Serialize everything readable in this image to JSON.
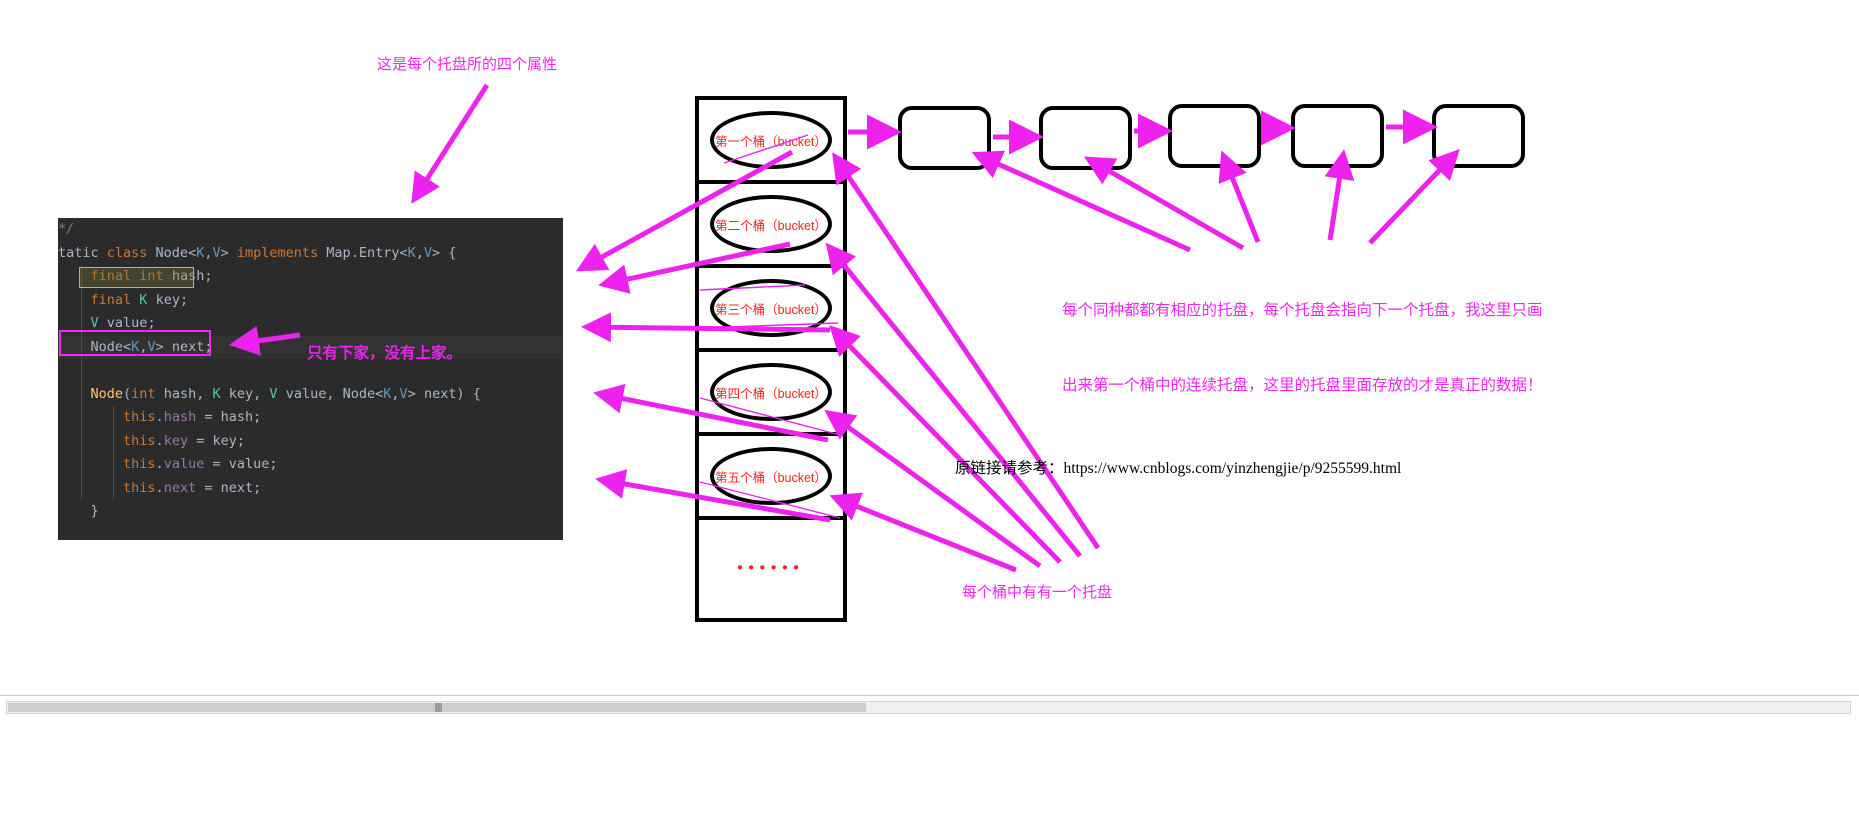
{
  "annotations": {
    "top": "这是每个托盘所的四个属性",
    "next_field": "只有下家，没有上家。",
    "right_line1": "每个同种都都有相应的托盘，每个托盘会指向下一个托盘，我这里只画",
    "right_line2": "出来第一个桶中的连续托盘，这里的托盘里面存放的才是真正的数据！",
    "bottom": "每个桶中有有一个托盘",
    "source_url": "原链接请参考：https://www.cnblogs.com/yinzhengjie/p/9255599.html"
  },
  "code": {
    "language": "java",
    "lines": [
      {
        "id": "l0",
        "text": "*/",
        "indent": 0,
        "highlighted": false
      },
      {
        "id": "l1",
        "text": "tatic class Node<K,V> implements Map.Entry<K,V> {",
        "indent": 0,
        "highlighted": false
      },
      {
        "id": "l2",
        "text": "    final int hash;",
        "indent": 1,
        "highlighted": false
      },
      {
        "id": "l3",
        "text": "    final K key;",
        "indent": 1,
        "highlighted": false
      },
      {
        "id": "l4",
        "text": "    V value;",
        "indent": 1,
        "highlighted": false
      },
      {
        "id": "l5",
        "text": "    Node<K,V> next;",
        "indent": 1,
        "highlighted": true
      },
      {
        "id": "l6",
        "text": "",
        "indent": 1,
        "highlighted": false
      },
      {
        "id": "l7",
        "text": "    Node(int hash, K key, V value, Node<K,V> next) {",
        "indent": 1,
        "highlighted": false
      },
      {
        "id": "l8",
        "text": "        this.hash = hash;",
        "indent": 2,
        "highlighted": false
      },
      {
        "id": "l9",
        "text": "        this.key = key;",
        "indent": 2,
        "highlighted": false
      },
      {
        "id": "l10",
        "text": "        this.value = value;",
        "indent": 2,
        "highlighted": false
      },
      {
        "id": "l11",
        "text": "        this.next = next;",
        "indent": 2,
        "highlighted": false
      },
      {
        "id": "l12",
        "text": "    }",
        "indent": 1,
        "highlighted": false
      }
    ],
    "selection_label": "final int hash;",
    "marked_field_label": "Node<K,V> next;"
  },
  "buckets": [
    {
      "id": "bucket-1",
      "label": "第一个桶（bucket）"
    },
    {
      "id": "bucket-2",
      "label": "第二个桶（bucket）"
    },
    {
      "id": "bucket-3",
      "label": "第三个桶（bucket）"
    },
    {
      "id": "bucket-4",
      "label": "第四个桶（bucket）"
    },
    {
      "id": "bucket-5",
      "label": "第五个桶（bucket）"
    },
    {
      "id": "bucket-more",
      "label": "••••••"
    }
  ],
  "linked_nodes": [
    {
      "id": "node-1",
      "label": ""
    },
    {
      "id": "node-2",
      "label": ""
    },
    {
      "id": "node-3",
      "label": ""
    },
    {
      "id": "node-4",
      "label": ""
    },
    {
      "id": "node-5",
      "label": ""
    }
  ],
  "colors": {
    "annotation": "#ef27ef",
    "bucket_label": "#ff2020",
    "editor_bg": "#2b2b2b",
    "editor_text": "#a9b7c6",
    "keyword": "#cc7832",
    "generic": "#6897bb",
    "type": "#4ec9b0",
    "method": "#ffc66d",
    "selection_border": "#b9b977"
  },
  "scrollbar": {
    "orientation": "horizontal",
    "thumb_label": ""
  }
}
